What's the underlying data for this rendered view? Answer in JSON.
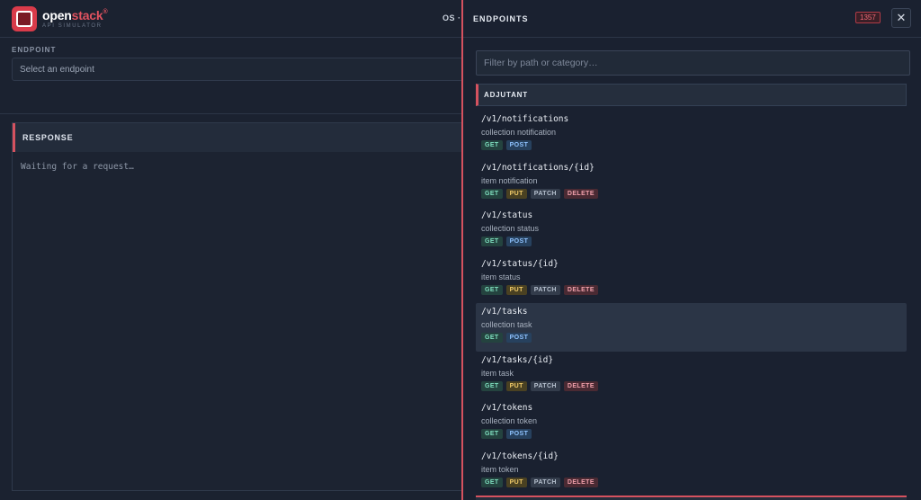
{
  "header": {
    "logo_name_a": "open",
    "logo_name_b": "stack",
    "logo_registered": "®",
    "logo_sub": "API SIMULATOR",
    "os_label": "OS ·"
  },
  "endpoint": {
    "label": "ENDPOINT",
    "placeholder": "Select an endpoint"
  },
  "response": {
    "title": "RESPONSE",
    "body": "Waiting for a request…"
  },
  "drawer": {
    "title": "ENDPOINTS",
    "count": "1357",
    "close_icon": "close-icon",
    "filter_placeholder": "Filter by path or category…",
    "category": "ADJUTANT",
    "endpoints": [
      {
        "path": "/v1/notifications",
        "desc": "collection notification",
        "methods": [
          "GET",
          "POST"
        ]
      },
      {
        "path": "/v1/notifications/{id}",
        "desc": "item notification",
        "methods": [
          "GET",
          "PUT",
          "PATCH",
          "DELETE"
        ]
      },
      {
        "path": "/v1/status",
        "desc": "collection status",
        "methods": [
          "GET",
          "POST"
        ]
      },
      {
        "path": "/v1/status/{id}",
        "desc": "item status",
        "methods": [
          "GET",
          "PUT",
          "PATCH",
          "DELETE"
        ]
      },
      {
        "path": "/v1/tasks",
        "desc": "collection task",
        "methods": [
          "GET",
          "POST"
        ],
        "selected": true
      },
      {
        "path": "/v1/tasks/{id}",
        "desc": "item task",
        "methods": [
          "GET",
          "PUT",
          "PATCH",
          "DELETE"
        ]
      },
      {
        "path": "/v1/tokens",
        "desc": "collection token",
        "methods": [
          "GET",
          "POST"
        ]
      },
      {
        "path": "/v1/tokens/{id}",
        "desc": "item token",
        "methods": [
          "GET",
          "PUT",
          "PATCH",
          "DELETE"
        ]
      }
    ]
  },
  "colors": {
    "accent": "#d5525f",
    "background": "#1b2230",
    "get": "#7fe0c0",
    "post": "#8fc3ff",
    "put": "#f2cc6a",
    "delete": "#f1a0ab"
  }
}
